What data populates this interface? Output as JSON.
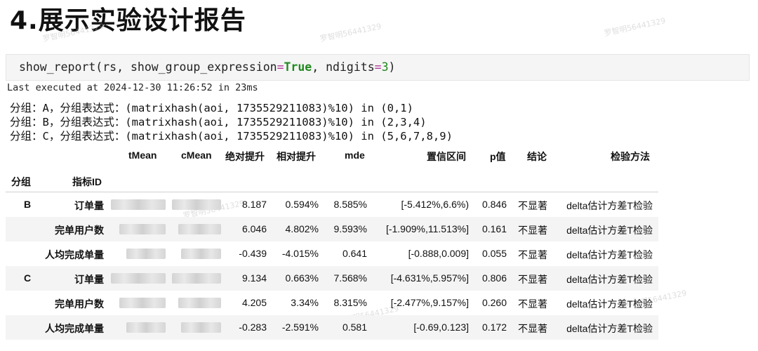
{
  "title": "4.展示实验设计报告",
  "watermark": "罗智明56441329",
  "code": {
    "fn": "show_report",
    "open": "(rs, show_group_expression",
    "eq": "=",
    "true_kw": "True",
    "mid": ", ndigits",
    "eq2": "=",
    "num": "3",
    "close": ")"
  },
  "exec_text": "Last executed at 2024-12-30 11:26:52 in 23ms",
  "output_lines": [
    "分组：A，分组表达式：(matrixhash(aoi, 1735529211083)%10) in (0,1)",
    "分组：B，分组表达式：(matrixhash(aoi, 1735529211083)%10) in (2,3,4)",
    "分组：C，分组表达式：(matrixhash(aoi, 1735529211083)%10) in (5,6,7,8,9)"
  ],
  "table": {
    "columns": [
      "tMean",
      "cMean",
      "绝对提升",
      "相对提升",
      "mde",
      "置信区间",
      "p值",
      "结论",
      "检验方法"
    ],
    "index_headers": [
      "分组",
      "指标ID"
    ],
    "rows": [
      {
        "group": "B",
        "metric": "订单量",
        "abs": "8.187",
        "rel": "0.594%",
        "mde": "8.585%",
        "ci": "[-5.412%,6.6%)",
        "p": "0.846",
        "conclusion": "不显著",
        "method": "delta估计方差T检验"
      },
      {
        "group": "",
        "metric": "完单用户数",
        "abs": "6.046",
        "rel": "4.802%",
        "mde": "9.593%",
        "ci": "[-1.909%,11.513%]",
        "p": "0.161",
        "conclusion": "不显著",
        "method": "delta估计方差T检验"
      },
      {
        "group": "",
        "metric": "人均完成单量",
        "abs": "-0.439",
        "rel": "-4.015%",
        "mde": "0.641",
        "ci": "[-0.888,0.009]",
        "p": "0.055",
        "conclusion": "不显著",
        "method": "delta估计方差T检验"
      },
      {
        "group": "C",
        "metric": "订单量",
        "abs": "9.134",
        "rel": "0.663%",
        "mde": "7.568%",
        "ci": "[-4.631%,5.957%]",
        "p": "0.806",
        "conclusion": "不显著",
        "method": "delta估计方差T检验"
      },
      {
        "group": "",
        "metric": "完单用户数",
        "abs": "4.205",
        "rel": "3.34%",
        "mde": "8.315%",
        "ci": "[-2.477%,9.157%]",
        "p": "0.260",
        "conclusion": "不显著",
        "method": "delta估计方差T检验"
      },
      {
        "group": "",
        "metric": "人均完成单量",
        "abs": "-0.283",
        "rel": "-2.591%",
        "mde": "0.581",
        "ci": "[-0.69,0.123]",
        "p": "0.172",
        "conclusion": "不显著",
        "method": "delta估计方差T检验"
      }
    ]
  },
  "colors": {
    "code_bg": "#f5f5f5",
    "keyword": "#1f8a1f",
    "operator": "#b2379a",
    "row_shade": "#f4f4f4"
  }
}
